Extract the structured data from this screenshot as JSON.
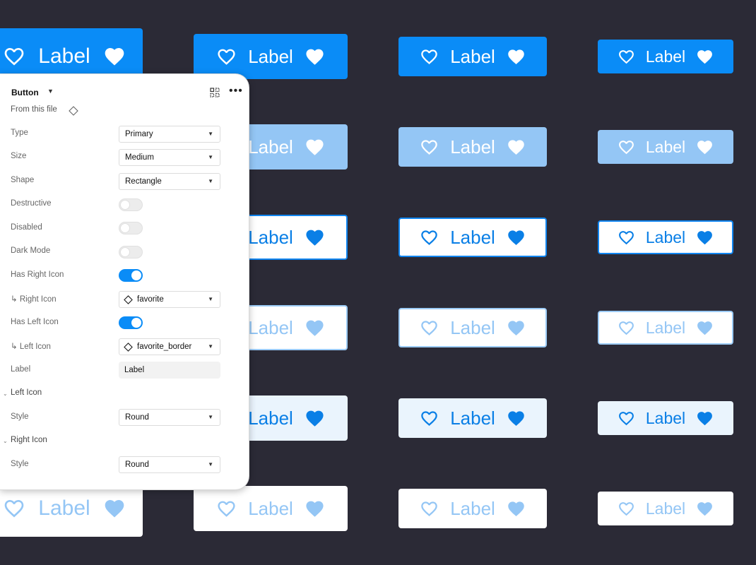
{
  "colors": {
    "background": "#2b2a36",
    "primary": "#0a8cf7",
    "primary_disabled": "#94c6f5",
    "text_blue": "#0a7fe6",
    "tint": "#eaf4fd"
  },
  "button_grid": {
    "label": "Label",
    "left_icon": "heart-outline-icon",
    "right_icon": "heart-filled-icon",
    "rows": [
      "primary",
      "primary-disabled",
      "outline",
      "outline-disabled",
      "tint",
      "tint-disabled"
    ],
    "columns": [
      "large",
      "medium",
      "small",
      "xsmall"
    ]
  },
  "panel": {
    "title": "Button",
    "source": "From this file",
    "properties": [
      {
        "label": "Type",
        "kind": "select",
        "value": "Primary"
      },
      {
        "label": "Size",
        "kind": "select",
        "value": "Medium"
      },
      {
        "label": "Shape",
        "kind": "select",
        "value": "Rectangle"
      },
      {
        "label": "Destructive",
        "kind": "toggle",
        "on": false
      },
      {
        "label": "Disabled",
        "kind": "toggle",
        "on": false
      },
      {
        "label": "Dark Mode",
        "kind": "toggle",
        "on": false
      },
      {
        "label": "Has Right Icon",
        "kind": "toggle",
        "on": true
      },
      {
        "label": "↳ Right Icon",
        "kind": "instance",
        "value": "favorite"
      },
      {
        "label": "Has Left Icon",
        "kind": "toggle",
        "on": true
      },
      {
        "label": "↳ Left Icon",
        "kind": "instance",
        "value": "favorite_border"
      },
      {
        "label": "Label",
        "kind": "text",
        "value": "Label"
      }
    ],
    "sections": [
      {
        "title": "Left Icon",
        "style_label": "Style",
        "style_value": "Round"
      },
      {
        "title": "Right Icon",
        "style_label": "Style",
        "style_value": "Round"
      }
    ]
  }
}
